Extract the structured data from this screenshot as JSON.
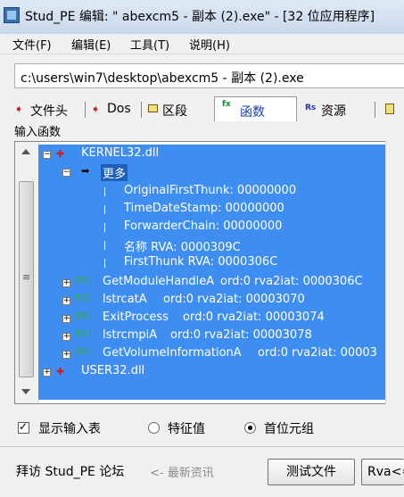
{
  "window": {
    "title": "Stud_PE 编辑: \"    abexcm5 - 副本 (2).exe\" - [32 位应用程序]"
  },
  "menu": [
    {
      "label": "文件(F)"
    },
    {
      "label": "编辑(E)"
    },
    {
      "label": "工具(T)"
    },
    {
      "label": "说明(H)"
    }
  ],
  "path": {
    "value": "c:\\users\\win7\\desktop\\abexcm5 - 副本 (2).exe"
  },
  "tabs": [
    {
      "icon": "red-arrow-icon",
      "label": "文件头"
    },
    {
      "icon": "red-arrow-icon",
      "label": "Dos"
    },
    {
      "icon": "section-icon",
      "label": "区段"
    },
    {
      "icon": "fx-icon",
      "icon_text": "fx",
      "label": "函数",
      "active": true
    },
    {
      "icon": "resource-icon",
      "icon_text": "Rs",
      "label": "资源"
    }
  ],
  "imports": {
    "group_label": "输入函数",
    "dlls": [
      {
        "name": "KERNEL32.dll",
        "more_label": "更多",
        "details": [
          "OriginalFirstThunk: 00000000",
          "TimeDateStamp: 00000000",
          "ForwarderChain: 00000000",
          "名称 RVA: 0000309C",
          "FirstThunk RVA: 0000306C"
        ],
        "func_prefix": "f(X)",
        "functions": [
          {
            "name": "GetModuleHandleA",
            "info": "ord:0 rva2iat: 0000306C"
          },
          {
            "name": "lstrcatA",
            "info": "ord:0 rva2iat: 00003070"
          },
          {
            "name": "ExitProcess",
            "info": "ord:0 rva2iat: 00003074"
          },
          {
            "name": "lstrcmpiA",
            "info": "ord:0 rva2iat: 00003078"
          },
          {
            "name": "GetVolumeInformationA",
            "info": "ord:0 rva2iat: 00003"
          }
        ]
      },
      {
        "name": "USER32.dll"
      }
    ]
  },
  "options": {
    "show_import_table": "显示输入表",
    "feature_value": "特征值",
    "first_tuple": "首位元组"
  },
  "bottom": {
    "visit": "拜访 Stud_PE 论坛",
    "latest": "<- 最新资讯",
    "test_file": "测试文件",
    "rva": "Rva<=>"
  }
}
